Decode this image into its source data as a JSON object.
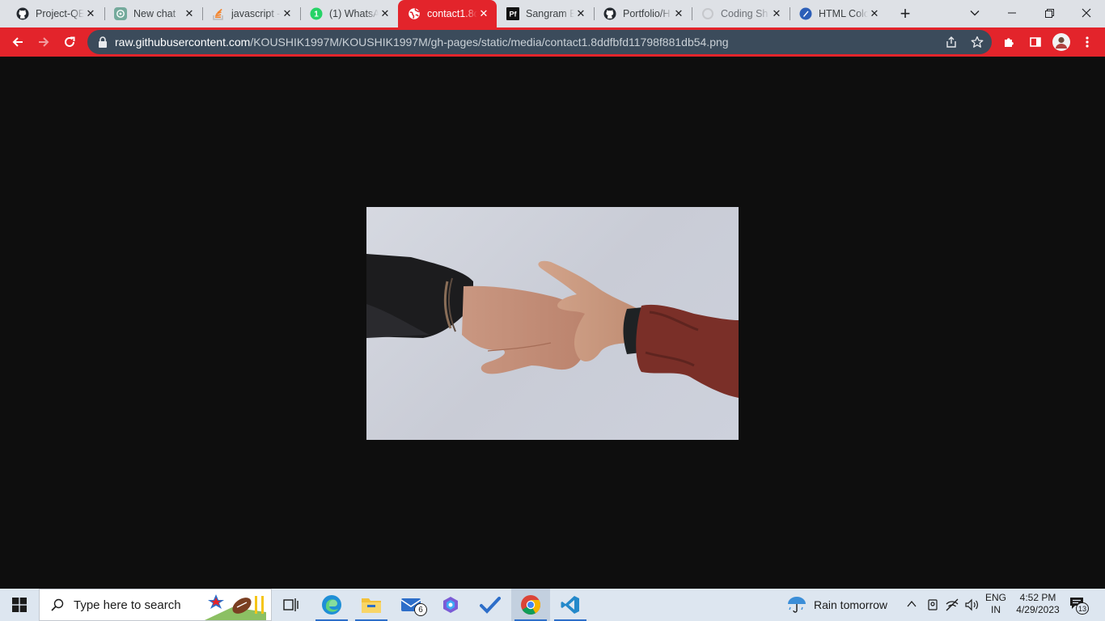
{
  "browser": {
    "tabs": [
      {
        "title": "Project-QE",
        "icon": "github-icon"
      },
      {
        "title": "New chat",
        "icon": "chatgpt-icon"
      },
      {
        "title": "javascript -",
        "icon": "stackoverflow-icon"
      },
      {
        "title": "(1) WhatsA",
        "icon": "whatsapp-icon"
      },
      {
        "title": "contact1.8d",
        "icon": "globe-icon",
        "active": true
      },
      {
        "title": "Sangram B",
        "icon": "pf-icon"
      },
      {
        "title": "Portfolio/H",
        "icon": "github-icon"
      },
      {
        "title": "Coding Sh",
        "icon": "loading-icon"
      },
      {
        "title": "HTML Colo",
        "icon": "html-color-icon"
      }
    ],
    "pf_favicon_text": "Pf",
    "whatsapp_badge": "1",
    "address": {
      "host": "raw.githubusercontent.com",
      "path": "/KOUSHIK1997M/KOUSHIK1997M/gh-pages/static/media/contact1.8ddfbfd11798f881db54.png"
    },
    "accent_color": "#e3242b"
  },
  "content": {
    "image_subject": "two hands reaching toward each other for a handshake",
    "background_color": "#0e0e0e"
  },
  "taskbar": {
    "search_placeholder": "Type here to search",
    "mail_badge": "6",
    "weather": "Rain tomorrow",
    "language": "ENG",
    "region": "IN",
    "time": "4:52 PM",
    "date": "4/29/2023",
    "notification_count": "13"
  }
}
